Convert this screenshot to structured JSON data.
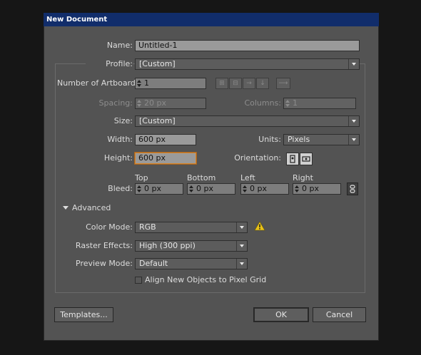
{
  "window": {
    "title": "New Document"
  },
  "name": {
    "label": "Name:",
    "value": "Untitled-1"
  },
  "profile": {
    "label": "Profile:",
    "value": "[Custom]"
  },
  "artboards": {
    "label": "Number of Artboards:",
    "value": "1"
  },
  "spacing": {
    "label": "Spacing:",
    "value": "20 px"
  },
  "columns": {
    "label": "Columns:",
    "value": "1"
  },
  "size": {
    "label": "Size:",
    "value": "[Custom]"
  },
  "width": {
    "label": "Width:",
    "value": "600 px"
  },
  "units": {
    "label": "Units:",
    "value": "Pixels"
  },
  "height": {
    "label": "Height:",
    "value": "600 px"
  },
  "orientation": {
    "label": "Orientation:"
  },
  "bleed": {
    "label": "Bleed:",
    "top": {
      "label": "Top",
      "value": "0 px"
    },
    "bottom": {
      "label": "Bottom",
      "value": "0 px"
    },
    "left": {
      "label": "Left",
      "value": "0 px"
    },
    "right": {
      "label": "Right",
      "value": "0 px"
    }
  },
  "advanced": {
    "label": "Advanced",
    "color_mode": {
      "label": "Color Mode:",
      "value": "RGB"
    },
    "raster_effects": {
      "label": "Raster Effects:",
      "value": "High (300 ppi)"
    },
    "preview_mode": {
      "label": "Preview Mode:",
      "value": "Default"
    },
    "align_pixel_grid": {
      "label": "Align New Objects to Pixel Grid",
      "checked": false
    }
  },
  "buttons": {
    "templates": "Templates...",
    "ok": "OK",
    "cancel": "Cancel"
  },
  "colors": {
    "warning": "#e8c21a",
    "focus": "#d6862a",
    "titlebar": "#112d6b"
  }
}
